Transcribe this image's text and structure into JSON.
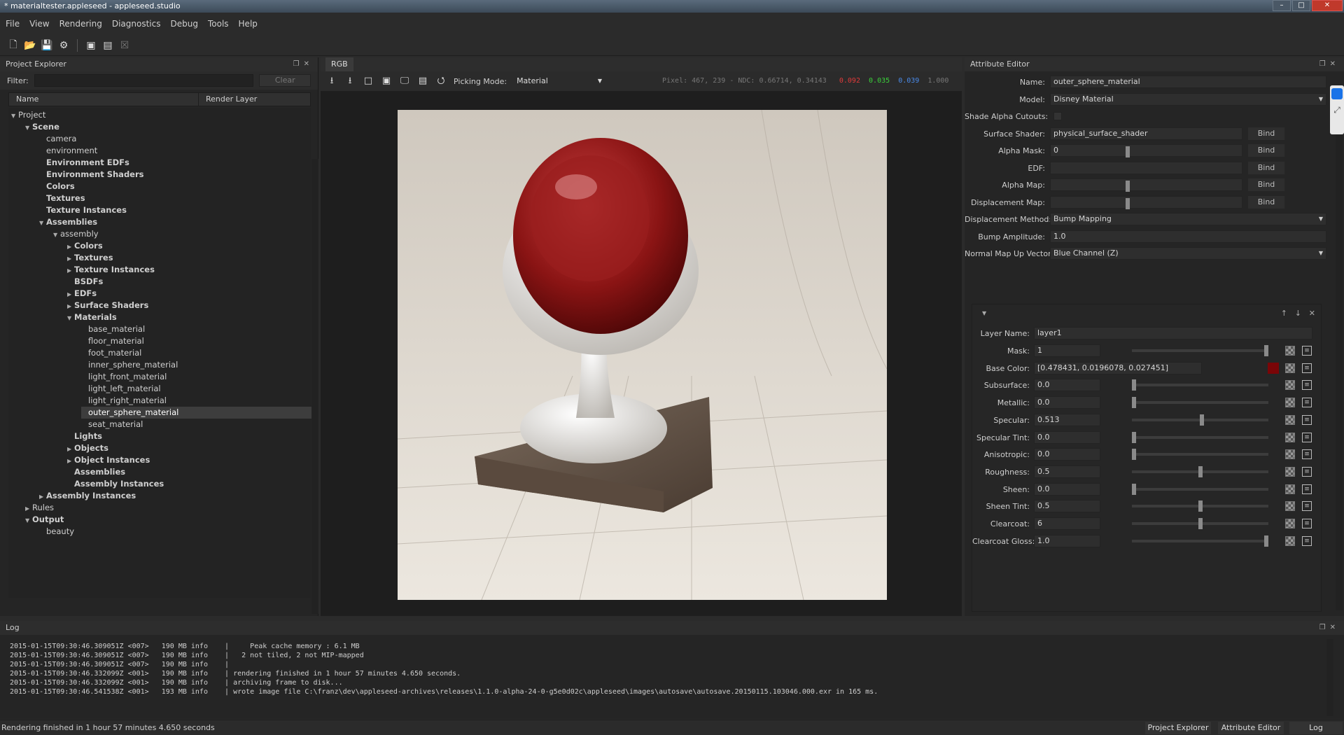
{
  "window": {
    "title": "* materialtester.appleseed - appleseed.studio",
    "buttons": [
      "–",
      "□",
      "✕"
    ]
  },
  "menu": [
    "File",
    "View",
    "Rendering",
    "Diagnostics",
    "Debug",
    "Tools",
    "Help"
  ],
  "toolbar_icons": [
    "new-file-icon",
    "open-folder-icon",
    "save-icon",
    "save-as-icon",
    "render-icon",
    "interactive-render-icon",
    "stop-render-icon"
  ],
  "project_explorer": {
    "title": "Project Explorer",
    "filter_label": "Filter:",
    "filter_value": "",
    "clear_label": "Clear",
    "columns": [
      "Name",
      "Render Layer"
    ],
    "tree": [
      {
        "label": "Project",
        "depth": 0,
        "arrow": "open",
        "bold": false
      },
      {
        "label": "Scene",
        "depth": 1,
        "arrow": "open",
        "bold": true
      },
      {
        "label": "camera",
        "depth": 2,
        "arrow": "",
        "bold": false
      },
      {
        "label": "environment",
        "depth": 2,
        "arrow": "",
        "bold": false
      },
      {
        "label": "Environment EDFs",
        "depth": 2,
        "arrow": "",
        "bold": true
      },
      {
        "label": "Environment Shaders",
        "depth": 2,
        "arrow": "",
        "bold": true
      },
      {
        "label": "Colors",
        "depth": 2,
        "arrow": "",
        "bold": true
      },
      {
        "label": "Textures",
        "depth": 2,
        "arrow": "",
        "bold": true
      },
      {
        "label": "Texture Instances",
        "depth": 2,
        "arrow": "",
        "bold": true
      },
      {
        "label": "Assemblies",
        "depth": 2,
        "arrow": "open",
        "bold": true
      },
      {
        "label": "assembly",
        "depth": 3,
        "arrow": "open",
        "bold": false
      },
      {
        "label": "Colors",
        "depth": 4,
        "arrow": "closed",
        "bold": true
      },
      {
        "label": "Textures",
        "depth": 4,
        "arrow": "closed",
        "bold": true
      },
      {
        "label": "Texture Instances",
        "depth": 4,
        "arrow": "closed",
        "bold": true
      },
      {
        "label": "BSDFs",
        "depth": 4,
        "arrow": "",
        "bold": true
      },
      {
        "label": "EDFs",
        "depth": 4,
        "arrow": "closed",
        "bold": true
      },
      {
        "label": "Surface Shaders",
        "depth": 4,
        "arrow": "closed",
        "bold": true
      },
      {
        "label": "Materials",
        "depth": 4,
        "arrow": "open",
        "bold": true
      },
      {
        "label": "base_material",
        "depth": 5,
        "arrow": "",
        "bold": false
      },
      {
        "label": "floor_material",
        "depth": 5,
        "arrow": "",
        "bold": false
      },
      {
        "label": "foot_material",
        "depth": 5,
        "arrow": "",
        "bold": false
      },
      {
        "label": "inner_sphere_material",
        "depth": 5,
        "arrow": "",
        "bold": false
      },
      {
        "label": "light_front_material",
        "depth": 5,
        "arrow": "",
        "bold": false
      },
      {
        "label": "light_left_material",
        "depth": 5,
        "arrow": "",
        "bold": false
      },
      {
        "label": "light_right_material",
        "depth": 5,
        "arrow": "",
        "bold": false
      },
      {
        "label": "outer_sphere_material",
        "depth": 5,
        "arrow": "",
        "bold": false,
        "selected": true
      },
      {
        "label": "seat_material",
        "depth": 5,
        "arrow": "",
        "bold": false
      },
      {
        "label": "Lights",
        "depth": 4,
        "arrow": "",
        "bold": true
      },
      {
        "label": "Objects",
        "depth": 4,
        "arrow": "closed",
        "bold": true
      },
      {
        "label": "Object Instances",
        "depth": 4,
        "arrow": "closed",
        "bold": true
      },
      {
        "label": "Assemblies",
        "depth": 4,
        "arrow": "",
        "bold": true
      },
      {
        "label": "Assembly Instances",
        "depth": 4,
        "arrow": "",
        "bold": true
      },
      {
        "label": "Assembly Instances",
        "depth": 2,
        "arrow": "closed",
        "bold": true
      },
      {
        "label": "Rules",
        "depth": 1,
        "arrow": "closed",
        "bold": false
      },
      {
        "label": "Output",
        "depth": 1,
        "arrow": "open",
        "bold": true
      },
      {
        "label": "beauty",
        "depth": 2,
        "arrow": "",
        "bold": false
      }
    ]
  },
  "viewport": {
    "tab": "RGB",
    "picking_label": "Picking Mode:",
    "picking_value": "Material",
    "pixel_info": "Pixel:   467,  239 - NDC: 0.66714, 0.34143",
    "r": "0.092",
    "g": "0.035",
    "b": "0.039",
    "a": "1.000",
    "r_color": "#e03a3a",
    "g_color": "#3ad03a",
    "b_color": "#4a8ae8"
  },
  "attribute_editor": {
    "title": "Attribute Editor",
    "fields": [
      {
        "label": "Name:",
        "value": "outer_sphere_material",
        "kind": "text"
      },
      {
        "label": "Model:",
        "value": "Disney Material",
        "kind": "dropdown"
      },
      {
        "label": "Shade Alpha Cutouts:",
        "value": "",
        "kind": "checkbox"
      },
      {
        "label": "Surface Shader:",
        "value": "physical_surface_shader",
        "kind": "bind"
      },
      {
        "label": "Alpha Mask:",
        "value": "0",
        "kind": "bind-slider"
      },
      {
        "label": "EDF:",
        "value": "",
        "kind": "bind"
      },
      {
        "label": "Alpha Map:",
        "value": "",
        "kind": "bind-slider"
      },
      {
        "label": "Displacement Map:",
        "value": "",
        "kind": "bind-slider"
      },
      {
        "label": "Displacement Method:",
        "value": "Bump Mapping",
        "kind": "dropdown"
      },
      {
        "label": "Bump Amplitude:",
        "value": "1.0",
        "kind": "text"
      },
      {
        "label": "Normal Map Up Vector:",
        "value": "Blue Channel (Z)",
        "kind": "dropdown"
      }
    ],
    "bind_label": "Bind",
    "layer": {
      "name_label": "Layer Name:",
      "name_value": "layer1",
      "params": [
        {
          "label": "Mask:",
          "value": "1",
          "level": 1.0
        },
        {
          "label": "Base Color:",
          "value": "[0.478431, 0.0196078, 0.027451]",
          "swatch": "#7a0507"
        },
        {
          "label": "Subsurface:",
          "value": "0.0",
          "level": 0.0
        },
        {
          "label": "Metallic:",
          "value": "0.0",
          "level": 0.0
        },
        {
          "label": "Specular:",
          "value": "0.513",
          "level": 0.513
        },
        {
          "label": "Specular Tint:",
          "value": "0.0",
          "level": 0.0
        },
        {
          "label": "Anisotropic:",
          "value": "0.0",
          "level": 0.0
        },
        {
          "label": "Roughness:",
          "value": "0.5",
          "level": 0.5
        },
        {
          "label": "Sheen:",
          "value": "0.0",
          "level": 0.0
        },
        {
          "label": "Sheen Tint:",
          "value": "0.5",
          "level": 0.5
        },
        {
          "label": "Clearcoat:",
          "value": "6",
          "level": 0.5
        },
        {
          "label": "Clearcoat Gloss:",
          "value": "1.0",
          "level": 1.0
        }
      ]
    }
  },
  "log": {
    "title": "Log",
    "lines": [
      "2015-01-15T09:30:46.309051Z <007>   190 MB info    |     Peak cache memory : 6.1 MB",
      "2015-01-15T09:30:46.309051Z <007>   190 MB info    |   2 not tiled, 2 not MIP-mapped",
      "2015-01-15T09:30:46.309051Z <007>   190 MB info    |",
      "2015-01-15T09:30:46.332099Z <001>   190 MB info    | rendering finished in 1 hour 57 minutes 4.650 seconds.",
      "2015-01-15T09:30:46.332099Z <001>   190 MB info    | archiving frame to disk...",
      "2015-01-15T09:30:46.541538Z <001>   193 MB info    | wrote image file C:\\franz\\dev\\appleseed-archives\\releases\\1.1.0-alpha-24-0-g5e0d02c\\appleseed\\images\\autosave\\autosave.20150115.103046.000.exr in 165 ms."
    ]
  },
  "status": {
    "text": "Rendering finished in 1 hour 57 minutes 4.650 seconds",
    "buttons": [
      "Project Explorer",
      "Attribute Editor",
      "Log"
    ]
  }
}
